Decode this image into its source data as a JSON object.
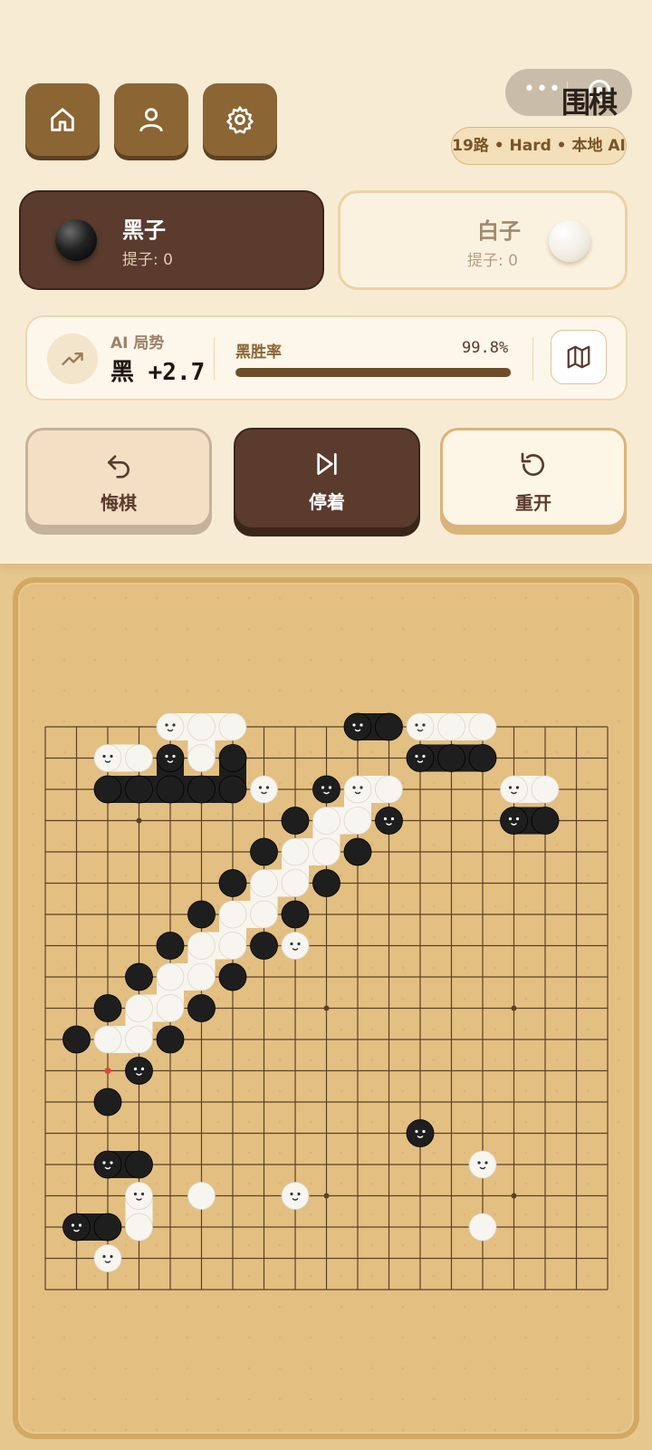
{
  "header": {
    "title": "围棋",
    "mode_label": "19路 • Hard • 本地 AI",
    "nav_icons": [
      "home-icon",
      "user-icon",
      "settings-icon"
    ],
    "capsule_icons": [
      "more-dots-icon",
      "record-circle-icon"
    ]
  },
  "players": {
    "black": {
      "name": "黑子",
      "captures": "提子: 0",
      "active": true
    },
    "white": {
      "name": "白子",
      "captures": "提子: 0",
      "active": false
    }
  },
  "status": {
    "ai_label": "AI 局势",
    "ai_score": "黑 +2.7",
    "win_label": "黑胜率",
    "win_value": "99.8%",
    "win_rate": 0.998
  },
  "actions": {
    "undo": "悔棋",
    "pass": "停着",
    "restart": "重开"
  },
  "board": {
    "size": 19,
    "star_points": [
      [
        3,
        3
      ],
      [
        9,
        3
      ],
      [
        15,
        3
      ],
      [
        3,
        9
      ],
      [
        9,
        9
      ],
      [
        15,
        9
      ],
      [
        3,
        15
      ],
      [
        9,
        15
      ],
      [
        15,
        15
      ]
    ],
    "groups": [
      {
        "color": "W",
        "pts": [
          [
            4,
            0
          ],
          [
            5,
            0
          ],
          [
            6,
            0
          ],
          [
            5,
            1
          ]
        ]
      },
      {
        "color": "W",
        "pts": [
          [
            2,
            1
          ],
          [
            3,
            1
          ]
        ]
      },
      {
        "color": "B",
        "pts": [
          [
            4,
            1
          ],
          [
            6,
            1
          ],
          [
            2,
            2
          ],
          [
            3,
            2
          ],
          [
            4,
            2
          ],
          [
            5,
            2
          ],
          [
            6,
            2
          ]
        ]
      },
      {
        "color": "W",
        "pts": [
          [
            7,
            2
          ]
        ]
      },
      {
        "color": "B",
        "pts": [
          [
            10,
            0
          ],
          [
            11,
            0
          ]
        ]
      },
      {
        "color": "W",
        "pts": [
          [
            12,
            0
          ],
          [
            13,
            0
          ],
          [
            14,
            0
          ]
        ]
      },
      {
        "color": "B",
        "pts": [
          [
            12,
            1
          ],
          [
            13,
            1
          ],
          [
            14,
            1
          ]
        ]
      },
      {
        "color": "W",
        "pts": [
          [
            15,
            2
          ],
          [
            16,
            2
          ]
        ]
      },
      {
        "color": "B",
        "pts": [
          [
            15,
            3
          ],
          [
            16,
            3
          ]
        ]
      },
      {
        "color": "W",
        "pts": [
          [
            10,
            2
          ],
          [
            11,
            2
          ],
          [
            9,
            3
          ],
          [
            10,
            3
          ],
          [
            8,
            4
          ],
          [
            9,
            4
          ],
          [
            7,
            5
          ],
          [
            8,
            5
          ],
          [
            6,
            6
          ],
          [
            7,
            6
          ],
          [
            5,
            7
          ],
          [
            6,
            7
          ],
          [
            4,
            8
          ],
          [
            5,
            8
          ],
          [
            3,
            9
          ],
          [
            4,
            9
          ],
          [
            2,
            10
          ],
          [
            3,
            10
          ]
        ]
      },
      {
        "color": "B",
        "pts": [
          [
            9,
            2
          ],
          [
            8,
            3
          ],
          [
            7,
            4
          ],
          [
            6,
            5
          ],
          [
            5,
            6
          ],
          [
            4,
            7
          ],
          [
            3,
            8
          ],
          [
            2,
            9
          ],
          [
            1,
            10
          ]
        ]
      },
      {
        "color": "B",
        "pts": [
          [
            11,
            3
          ],
          [
            10,
            4
          ],
          [
            9,
            5
          ],
          [
            8,
            6
          ],
          [
            7,
            7
          ],
          [
            6,
            8
          ],
          [
            5,
            9
          ],
          [
            4,
            10
          ]
        ]
      },
      {
        "color": "W",
        "pts": [
          [
            8,
            7
          ]
        ]
      },
      {
        "color": "B",
        "pts": [
          [
            3,
            11
          ],
          [
            2,
            12
          ]
        ]
      },
      {
        "color": "B",
        "pts": [
          [
            12,
            13
          ]
        ]
      },
      {
        "color": "B",
        "pts": [
          [
            2,
            14
          ],
          [
            3,
            14
          ]
        ]
      },
      {
        "color": "W",
        "pts": [
          [
            3,
            15
          ],
          [
            3,
            16
          ],
          [
            5,
            15
          ]
        ]
      },
      {
        "color": "B",
        "pts": [
          [
            1,
            16
          ],
          [
            2,
            16
          ]
        ]
      },
      {
        "color": "W",
        "pts": [
          [
            2,
            17
          ]
        ]
      },
      {
        "color": "W",
        "pts": [
          [
            8,
            15
          ]
        ]
      },
      {
        "color": "W",
        "pts": [
          [
            14,
            14
          ],
          [
            14,
            16
          ]
        ]
      }
    ],
    "last_move": [
      2,
      11
    ],
    "colors": {
      "board": "#e3bf82",
      "grid": "#5d4027",
      "black": "#1e1e1e",
      "white": "#f7f5f0",
      "accent_dark": "#5a3b2e",
      "accent_gold": "#8b6533"
    }
  }
}
